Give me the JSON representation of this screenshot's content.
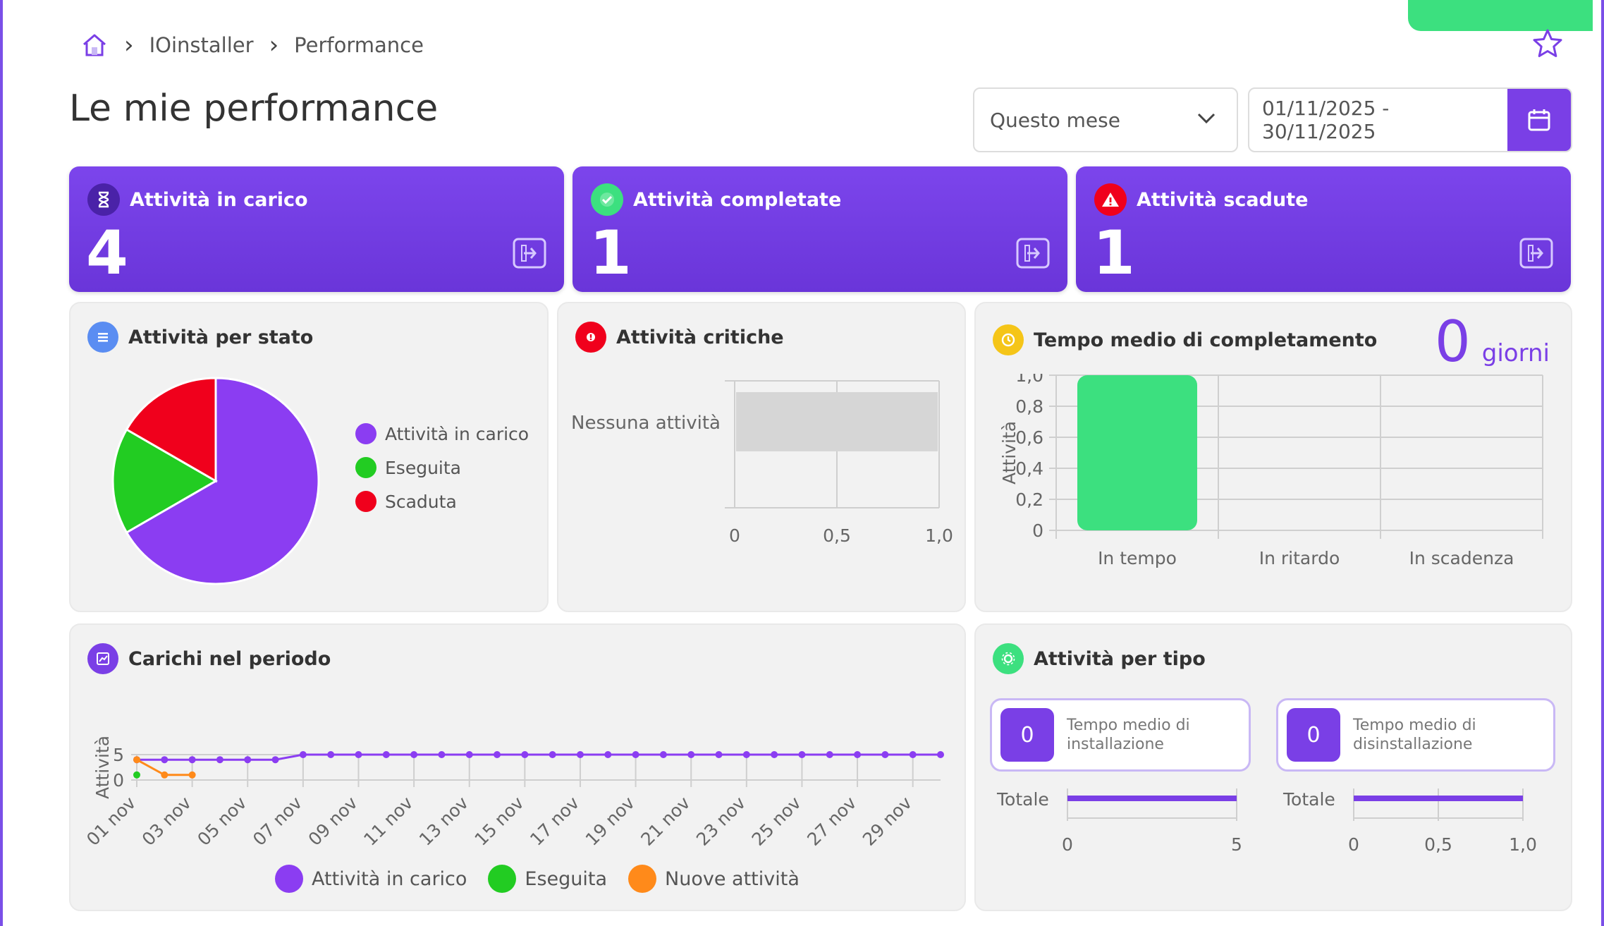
{
  "breadcrumb": {
    "items": [
      "IOinstaller",
      "Performance"
    ]
  },
  "page": {
    "title": "Le mie performance"
  },
  "filters": {
    "period": "Questo mese",
    "date_range": "01/11/2025 - 30/11/2025"
  },
  "kpis": [
    {
      "label": "Attività in carico",
      "value": "4",
      "icon": "hourglass-icon"
    },
    {
      "label": "Attività completate",
      "value": "1",
      "icon": "check-icon"
    },
    {
      "label": "Attività scadute",
      "value": "1",
      "icon": "warning-icon"
    }
  ],
  "cards": {
    "status": {
      "title": "Attività per stato"
    },
    "critical": {
      "title": "Attività critiche"
    },
    "avgtime": {
      "title": "Tempo medio di completamento",
      "value": "0",
      "unit": "giorni"
    },
    "loads": {
      "title": "Carichi nel periodo"
    },
    "types": {
      "title": "Attività per tipo",
      "install": {
        "value": "0",
        "label": "Tempo medio di installazione"
      },
      "uninstall": {
        "value": "0",
        "label": "Tempo medio di disinstallazione"
      }
    }
  },
  "colors": {
    "accent": "#7a3fe6",
    "green": "#3ce07f",
    "red": "#f0001c",
    "pie_green": "#22cc22",
    "orange": "#ff8a1a"
  },
  "chart_data": [
    {
      "type": "pie",
      "slices": [
        {
          "name": "Attività in carico",
          "value": 4,
          "color": "#8b3df2"
        },
        {
          "name": "Eseguita",
          "value": 1,
          "color": "#22cc22"
        },
        {
          "name": "Scaduta",
          "value": 1,
          "color": "#f0001c"
        }
      ]
    },
    {
      "type": "bar",
      "orientation": "horizontal",
      "categories": [
        "Nessuna attività"
      ],
      "values": [
        1.0
      ],
      "xlim": [
        0,
        1.0
      ],
      "xticks": [
        "0",
        "0,5",
        "1,0"
      ]
    },
    {
      "type": "bar",
      "categories": [
        "In tempo",
        "In ritardo",
        "In scadenza"
      ],
      "values": [
        1,
        0,
        0
      ],
      "ylabel": "Attività",
      "ylim": [
        0,
        1.0
      ],
      "yticks": [
        "0",
        "0,2",
        "0,4",
        "0,6",
        "0,8",
        "1,0"
      ]
    },
    {
      "type": "line",
      "ylabel": "Attività",
      "ylim": [
        0,
        5
      ],
      "yticks": [
        "0",
        "5"
      ],
      "x": [
        "01 nov",
        "02 nov",
        "03 nov",
        "04 nov",
        "05 nov",
        "06 nov",
        "07 nov",
        "08 nov",
        "09 nov",
        "10 nov",
        "11 nov",
        "12 nov",
        "13 nov",
        "14 nov",
        "15 nov",
        "16 nov",
        "17 nov",
        "18 nov",
        "19 nov",
        "20 nov",
        "21 nov",
        "22 nov",
        "23 nov",
        "24 nov",
        "25 nov",
        "26 nov",
        "27 nov",
        "28 nov",
        "29 nov",
        "30 nov"
      ],
      "xtick_labels": [
        "01 nov",
        "03 nov",
        "05 nov",
        "07 nov",
        "09 nov",
        "11 nov",
        "13 nov",
        "15 nov",
        "17 nov",
        "19 nov",
        "21 nov",
        "23 nov",
        "25 nov",
        "27 nov",
        "29 nov"
      ],
      "series": [
        {
          "name": "Attività in carico",
          "color": "#8b3df2",
          "values": [
            4,
            4,
            4,
            4,
            4,
            4,
            5,
            5,
            5,
            5,
            5,
            5,
            5,
            5,
            5,
            5,
            5,
            5,
            5,
            5,
            5,
            5,
            5,
            5,
            5,
            5,
            5,
            5,
            5,
            5
          ]
        },
        {
          "name": "Eseguita",
          "color": "#22cc22",
          "values": [
            1
          ]
        },
        {
          "name": "Nuove attività",
          "color": "#ff8a1a",
          "values": [
            4,
            1,
            1
          ]
        }
      ]
    },
    {
      "type": "bar",
      "orientation": "horizontal",
      "categories": [
        "Totale"
      ],
      "values": [
        5
      ],
      "xlim": [
        0,
        5
      ],
      "xticks": [
        "0",
        "5"
      ]
    },
    {
      "type": "bar",
      "orientation": "horizontal",
      "categories": [
        "Totale"
      ],
      "values": [
        1.0
      ],
      "xlim": [
        0,
        1.0
      ],
      "xticks": [
        "0",
        "0,5",
        "1,0"
      ]
    }
  ]
}
